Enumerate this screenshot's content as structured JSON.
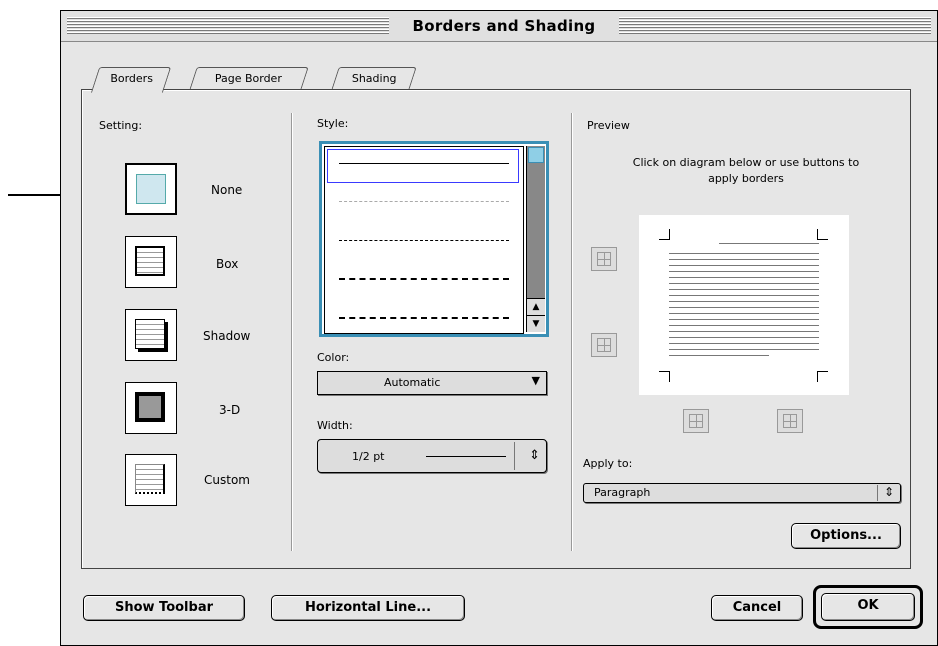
{
  "window": {
    "title": "Borders and Shading"
  },
  "tabs": [
    {
      "label": "Borders"
    },
    {
      "label": "Page Border"
    },
    {
      "label": "Shading"
    }
  ],
  "setting": {
    "label": "Setting:",
    "options": [
      {
        "name": "None",
        "selected": true
      },
      {
        "name": "Box"
      },
      {
        "name": "Shadow"
      },
      {
        "name": "3-D"
      },
      {
        "name": "Custom"
      }
    ]
  },
  "style": {
    "label": "Style:",
    "line_styles": [
      "solid",
      "dotted",
      "dashed",
      "long-dash",
      "dash-dot"
    ]
  },
  "color": {
    "label": "Color:",
    "value": "Automatic"
  },
  "width": {
    "label": "Width:",
    "value": "1/2 pt"
  },
  "preview": {
    "label": "Preview",
    "hint": "Click on diagram below or use buttons to apply borders"
  },
  "apply_to": {
    "label": "Apply to:",
    "value": "Paragraph"
  },
  "buttons": {
    "options": "Options...",
    "show_toolbar": "Show Toolbar",
    "horizontal_line": "Horizontal Line...",
    "cancel": "Cancel",
    "ok": "OK"
  },
  "colors": {
    "selection_accent": "#3a8fb5",
    "window_bg": "#e6e6e6"
  }
}
